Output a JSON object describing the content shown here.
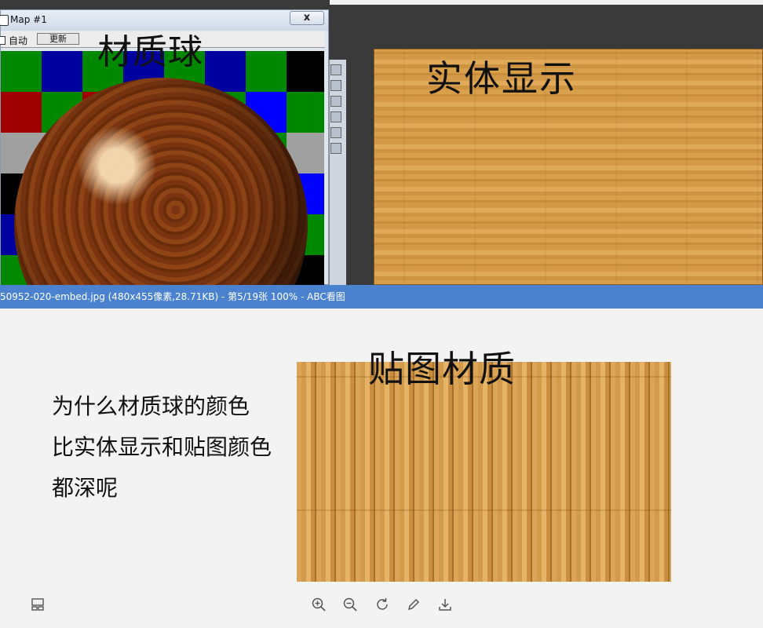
{
  "material_window": {
    "title": "Map #1",
    "close_label": "x",
    "auto_label": "自动",
    "update_label": "更新",
    "checker_colors": [
      "#008800",
      "#0000a0",
      "#a00000",
      "#a0a0a0",
      "#000000",
      "#ff0000",
      "#ffffff",
      "#0000ff"
    ]
  },
  "labels": {
    "material_ball": "材质球",
    "solid_display": "实体显示",
    "texture_material": "贴图材质"
  },
  "statusbar": {
    "text": "50952-020-embed.jpg (480x455像素,28.71KB) - 第5/19张 100% - ABC看图"
  },
  "question": {
    "line1": "为什么材质球的颜色",
    "line2": "比实体显示和贴图颜色",
    "line3": "都深呢"
  },
  "toolbar": {
    "zoom_in": "zoom-in-icon",
    "zoom_out": "zoom-out-icon",
    "rotate": "rotate-icon",
    "edit": "edit-icon",
    "download": "download-icon",
    "thumbnail": "thumbnail-icon"
  }
}
